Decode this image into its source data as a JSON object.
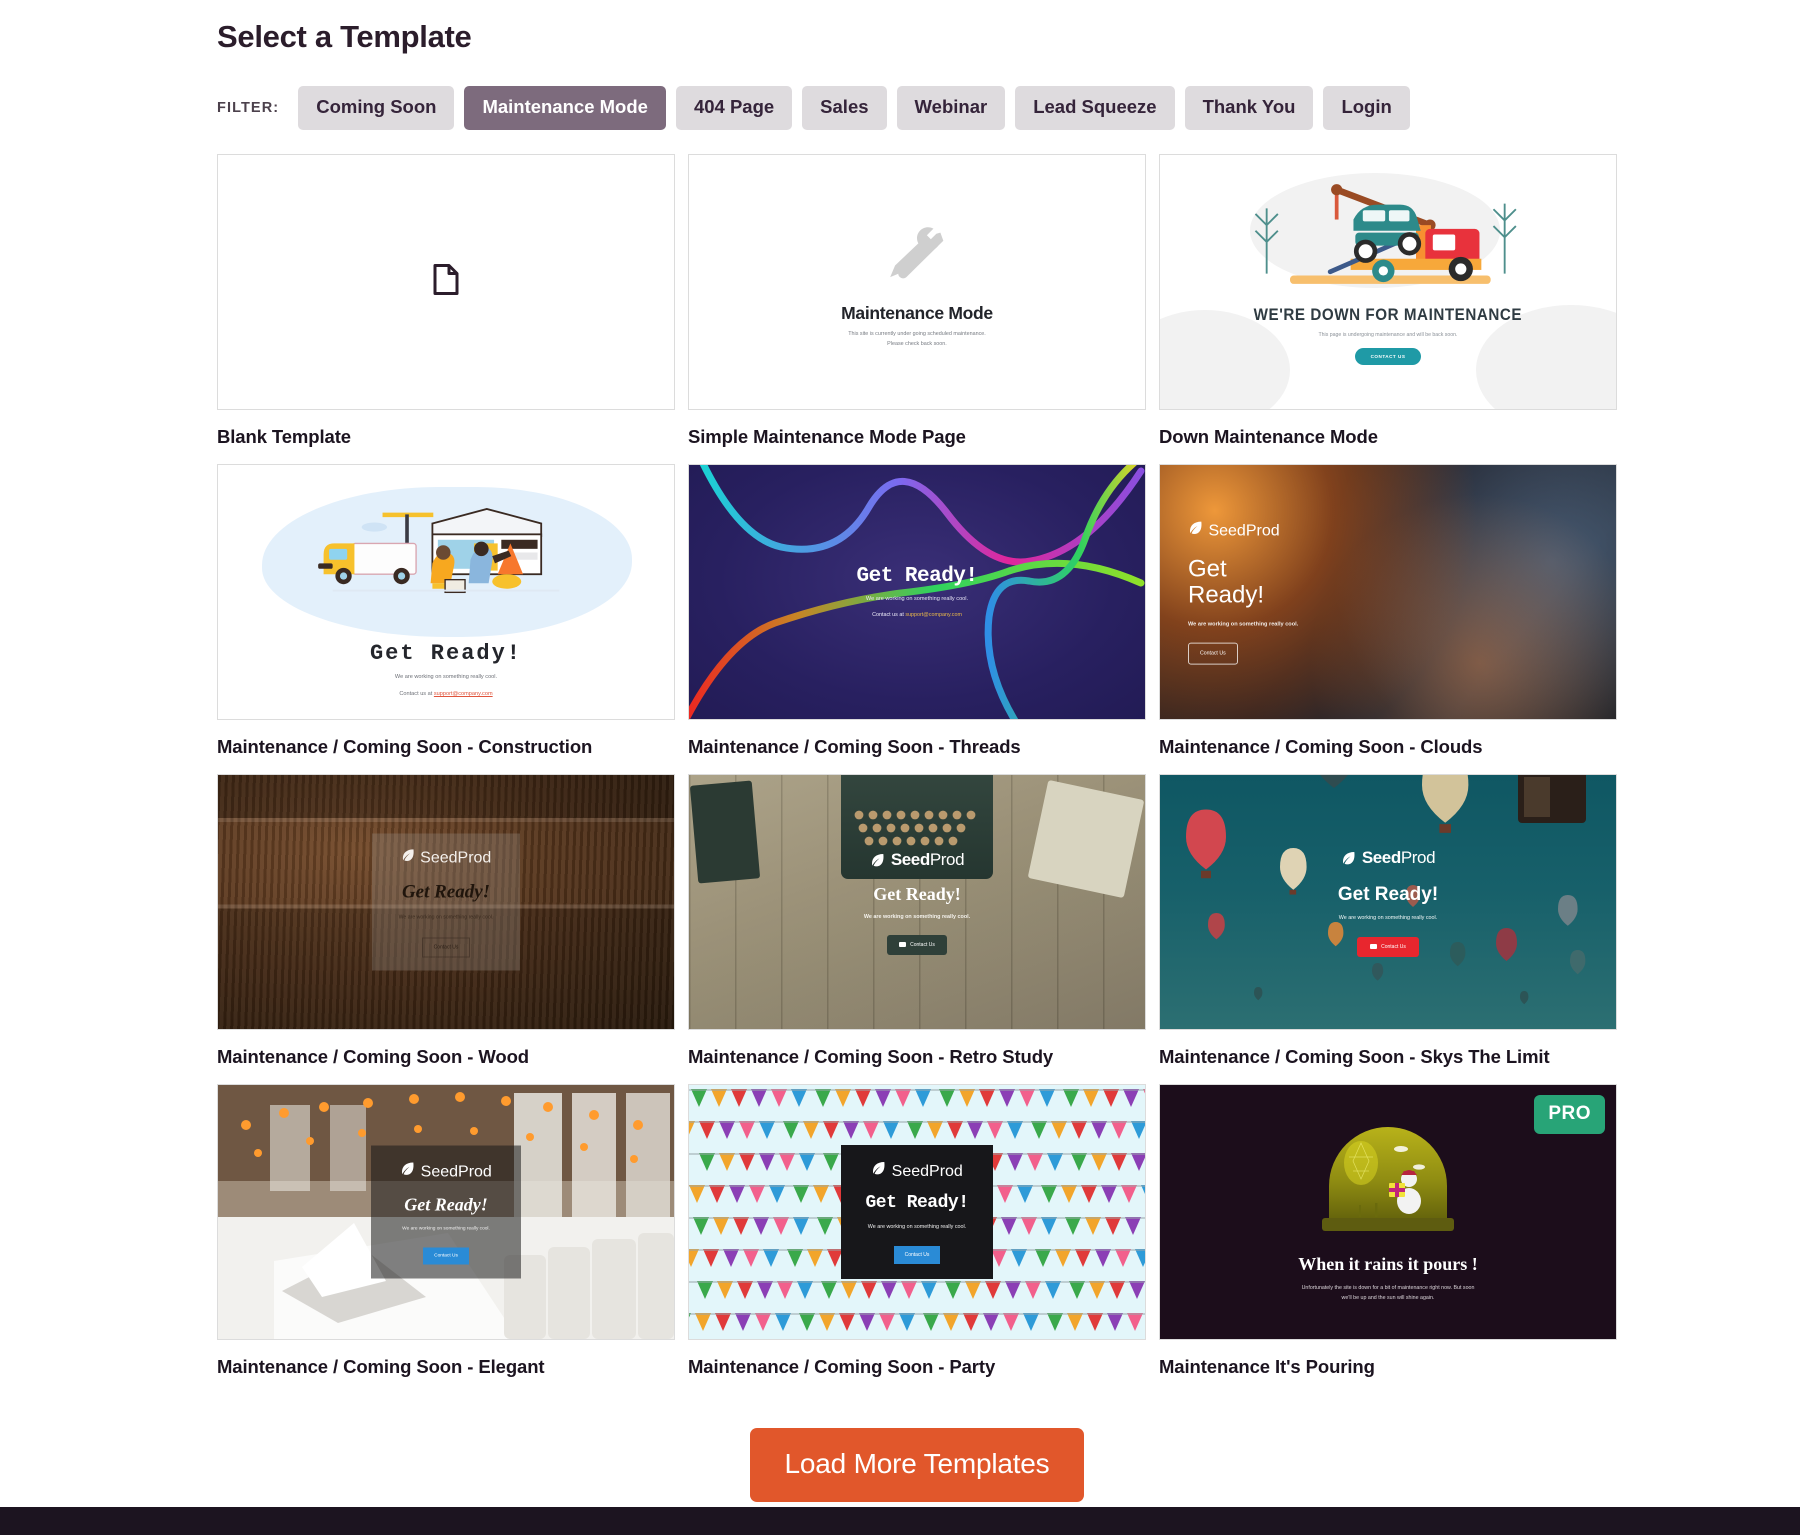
{
  "header": {
    "title": "Select a Template",
    "filter_label": "FILTER:",
    "filters": [
      {
        "label": "Coming Soon",
        "active": false
      },
      {
        "label": "Maintenance Mode",
        "active": true
      },
      {
        "label": "404 Page",
        "active": false
      },
      {
        "label": "Sales",
        "active": false
      },
      {
        "label": "Webinar",
        "active": false
      },
      {
        "label": "Lead Squeeze",
        "active": false
      },
      {
        "label": "Thank You",
        "active": false
      },
      {
        "label": "Login",
        "active": false
      }
    ]
  },
  "brand": {
    "logo_text_1": "Seed",
    "logo_text_2": "Prod",
    "accent_orange": "#e1572b",
    "chip_bg": "#dedbde",
    "chip_active_bg": "#7d6b7d",
    "pro_badge_bg": "#28a477"
  },
  "templates": [
    {
      "title": "Blank Template",
      "preview": {
        "kind": "blank",
        "icon": "document-icon"
      }
    },
    {
      "title": "Simple Maintenance Mode Page",
      "preview": {
        "kind": "simple",
        "icon": "wrench-screwdriver-icon",
        "headline": "Maintenance Mode",
        "sub_line_1": "This site is currently under going scheduled maintenance.",
        "sub_line_2": "Please check back soon."
      }
    },
    {
      "title": "Down Maintenance Mode",
      "preview": {
        "kind": "down",
        "illustration": "tow-truck-illustration",
        "headline": "WE'RE DOWN FOR MAINTENANCE",
        "sub": "This page is undergoing maintenance and will be back soon.",
        "button": "CONTACT US"
      }
    },
    {
      "title": "Maintenance / Coming Soon - Construction",
      "preview": {
        "kind": "construction",
        "illustration": "delivery-truck-warehouse-illustration",
        "headline": "Get Ready!",
        "sub": "We are working on something really cool.",
        "contact_prefix": "Contact us at ",
        "contact_email": "support@company.com"
      }
    },
    {
      "title": "Maintenance / Coming Soon - Threads",
      "preview": {
        "kind": "threads",
        "headline": "Get Ready!",
        "sub": "We are working on something really cool.",
        "contact_prefix": "Contact us at ",
        "contact_email": "support@company.com"
      }
    },
    {
      "title": "Maintenance / Coming Soon - Clouds",
      "preview": {
        "kind": "clouds",
        "headline_line_1": "Get",
        "headline_line_2": "Ready!",
        "sub": "We are working on something really cool.",
        "button": "Contact Us"
      }
    },
    {
      "title": "Maintenance / Coming Soon - Wood",
      "preview": {
        "kind": "wood",
        "headline": "Get Ready!",
        "sub": "We are working on something really cool.",
        "button": "Contact Us"
      }
    },
    {
      "title": "Maintenance / Coming Soon - Retro Study",
      "preview": {
        "kind": "retro",
        "headline": "Get Ready!",
        "sub": "We are working on something really cool.",
        "button": "Contact Us"
      }
    },
    {
      "title": "Maintenance / Coming Soon - Skys The Limit",
      "preview": {
        "kind": "skys",
        "headline": "Get Ready!",
        "sub": "We are working on something really cool.",
        "button": "Contact Us"
      }
    },
    {
      "title": "Maintenance / Coming Soon - Elegant",
      "preview": {
        "kind": "elegant",
        "headline": "Get Ready!",
        "sub": "We are working on something really cool.",
        "button": "Contact Us"
      }
    },
    {
      "title": "Maintenance / Coming Soon - Party",
      "preview": {
        "kind": "party",
        "headline": "Get Ready!",
        "sub": "We are working on something really cool.",
        "button": "Contact Us"
      }
    },
    {
      "title": "Maintenance It's Pouring",
      "badge": "PRO",
      "preview": {
        "kind": "pouring",
        "headline": "When it rains it pours !",
        "sub_line_1": "Unfortunately the site is down for a bit of maintenance right now. But soon",
        "sub_line_2": "we'll be up and the sun will shine again."
      }
    }
  ],
  "footer": {
    "load_more_label": "Load More Templates"
  }
}
